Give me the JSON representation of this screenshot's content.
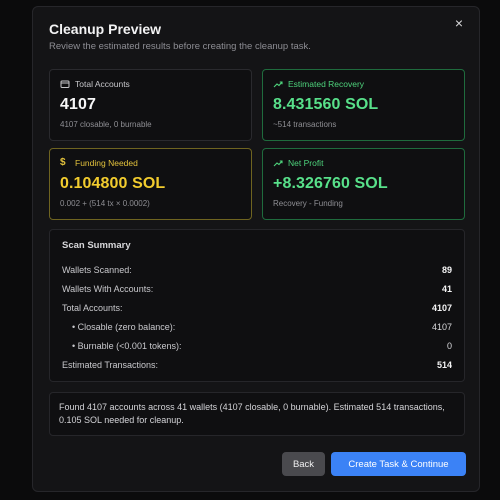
{
  "modal": {
    "title": "Cleanup Preview",
    "subtitle": "Review the estimated results before creating the cleanup task.",
    "close_glyph": "×"
  },
  "cards": {
    "total_accounts": {
      "label": "Total Accounts",
      "value": "4107",
      "sub": "4107 closable, 0 burnable",
      "icon": "wallet-icon"
    },
    "estimated_recovery": {
      "label": "Estimated Recovery",
      "value": "8.431560 SOL",
      "sub": "~514 transactions",
      "icon": "trending-up-icon"
    },
    "funding_needed": {
      "label": "Funding Needed",
      "value": "0.104800 SOL",
      "sub": "0.002 + (514 tx × 0.0002)",
      "icon": "dollar-icon"
    },
    "net_profit": {
      "label": "Net Profit",
      "value": "+8.326760 SOL",
      "sub": "Recovery - Funding",
      "icon": "trending-up-icon"
    }
  },
  "summary": {
    "title": "Scan Summary",
    "rows": [
      {
        "label": "Wallets Scanned:",
        "value": "89"
      },
      {
        "label": "Wallets With Accounts:",
        "value": "41"
      },
      {
        "label": "Total Accounts:",
        "value": "4107"
      },
      {
        "label": "• Closable (zero balance):",
        "value": "4107"
      },
      {
        "label": "• Burnable (<0.001 tokens):",
        "value": "0"
      },
      {
        "label": "Estimated Transactions:",
        "value": "514"
      }
    ]
  },
  "note": "Found 4107 accounts across 41 wallets (4107 closable, 0 burnable). Estimated 514 transactions, 0.105 SOL needed for cleanup.",
  "buttons": {
    "back": "Back",
    "create": "Create Task & Continue"
  },
  "colors": {
    "accent": "#3b82f6",
    "success": "#58e08a",
    "warning": "#f2cc2e",
    "background": "#141416"
  }
}
